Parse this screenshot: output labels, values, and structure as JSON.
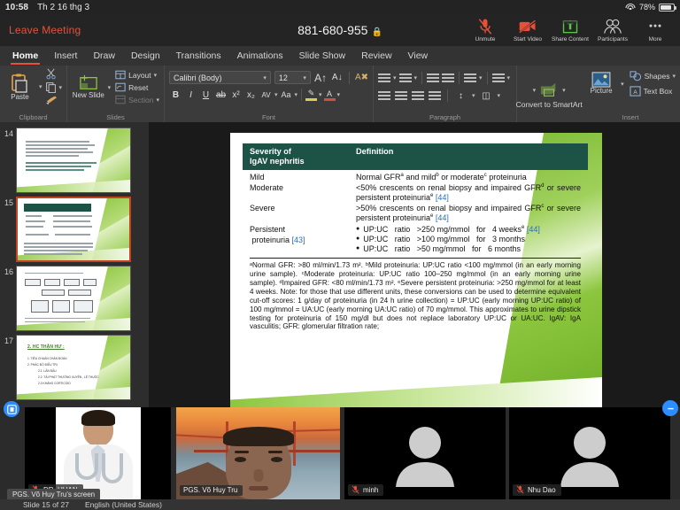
{
  "status_bar": {
    "time": "10:58",
    "date": "Th 2 16 thg 3",
    "battery_percent": "78%",
    "wifi_icon": "wifi-icon",
    "battery_icon": "battery-icon"
  },
  "zoom_bar": {
    "leave_label": "Leave Meeting",
    "meeting_id": "881-680-955",
    "lock_icon": "lock-icon",
    "tools": [
      {
        "label": "Unmute",
        "icon": "microphone-muted-icon"
      },
      {
        "label": "Start Video",
        "icon": "camera-off-icon"
      },
      {
        "label": "Share Content",
        "icon": "share-upload-icon"
      },
      {
        "label": "Participants",
        "icon": "participants-icon"
      },
      {
        "label": "More",
        "icon": "more-dots-icon"
      }
    ]
  },
  "ribbon": {
    "tabs": [
      {
        "label": "Home",
        "active": true
      },
      {
        "label": "Insert",
        "active": false
      },
      {
        "label": "Draw",
        "active": false
      },
      {
        "label": "Design",
        "active": false
      },
      {
        "label": "Transitions",
        "active": false
      },
      {
        "label": "Animations",
        "active": false
      },
      {
        "label": "Slide Show",
        "active": false
      },
      {
        "label": "Review",
        "active": false
      },
      {
        "label": "View",
        "active": false
      }
    ],
    "clipboard": {
      "group_label": "Clipboard",
      "paste_label": "Paste",
      "cut_icon": "scissors-icon",
      "copy_icon": "copy-icon",
      "format_painter_icon": "format-painter-icon"
    },
    "slides": {
      "group_label": "Slides",
      "new_slide_label": "New Slide",
      "layout_label": "Layout",
      "reset_label": "Reset",
      "section_label": "Section"
    },
    "font": {
      "group_label": "Font",
      "font_name": "Calibri (Body)",
      "font_size": "12",
      "grow_icon": "increase-font-size-icon",
      "shrink_icon": "decrease-font-size-icon",
      "clear_format_icon": "clear-formatting-icon",
      "bold": "B",
      "italic": "I",
      "underline": "U",
      "strikethrough": "ab",
      "superscript": "x²",
      "subscript": "x₂",
      "char_spacing": "AV",
      "change_case": "Aa",
      "highlight_icon": "text-highlight-icon",
      "font_color_icon": "font-color-icon"
    },
    "paragraph": {
      "group_label": "Paragraph",
      "bullets_icon": "bulleted-list-icon",
      "numbering_icon": "numbered-list-icon",
      "decrease_indent_icon": "decrease-indent-icon",
      "increase_indent_icon": "increase-indent-icon",
      "line_spacing_icon": "line-spacing-icon",
      "columns_icon": "columns-icon",
      "align_left_icon": "align-left-icon",
      "align_center_icon": "align-center-icon",
      "align_right_icon": "align-right-icon",
      "justify_icon": "justify-icon",
      "text_direction_icon": "text-direction-icon",
      "align_text_icon": "align-text-icon",
      "convert_smartart_label": "Convert to SmartArt"
    },
    "insert": {
      "group_label": "Insert",
      "picture_label": "Picture",
      "shapes_label": "Shapes",
      "text_box_label": "Text Box"
    }
  },
  "thumbnails": [
    {
      "number": "14",
      "selected": false,
      "kind": "text"
    },
    {
      "number": "15",
      "selected": true,
      "kind": "table"
    },
    {
      "number": "16",
      "selected": false,
      "kind": "diagram"
    },
    {
      "number": "17",
      "selected": false,
      "kind": "title",
      "title": "2. HC THẬN HƯ :",
      "lines": [
        "1. TIÊU CHUẨN CHẨN ĐOÁN",
        "2. PHÁC ĐỒ ĐIỀU TRỊ",
        "2.1. LẦN ĐẦU",
        "2.2. TÁI PHÁT THƯỜNG XUYÊN , LỆ THUỘC",
        "2.3 KHÁNG CORTICOID"
      ]
    }
  ],
  "slide": {
    "table": {
      "header": {
        "col1": "Severity of\nIgAV nephritis",
        "col2": "Definition"
      },
      "rows": [
        {
          "term": "Mild",
          "definition": "Normal GFR<sup>a</sup> and mild<sup>b</sup> or moderate<sup>c</sup> proteinuria"
        },
        {
          "term": "Moderate",
          "definition": "<50% crescents on renal biopsy and impaired GFR<sup>d</sup> or severe persistent proteinuria<sup>e</sup> [44]"
        },
        {
          "term": "Severe",
          "definition": ">50% crescents on renal biopsy and impaired GFR<sup>c</sup> or severe persistent proteinuria<sup>e</sup> [44]"
        }
      ],
      "persistent": {
        "term": "Persistent proteinuria [43]",
        "bullets": [
          "UP:UC  ratio  >250 mg/mmol  for  4 weeks<sup>e</sup> [44]",
          "UP:UC  ratio  >100 mg/mmol  for  3 months",
          "UP:UC  ratio  >50 mg/mmol  for  6 months"
        ]
      },
      "footnote": "ᵃNormal GFR: >80 ml/min/1.73 m². ᵇMild proteinuria: UP:UC ratio <100 mg/mmol (in an early morning urine sample). ᶜModerate proteinuria: UP:UC ratio 100–250 mg/mmol (in an early morning urine sample). ᵈImpaired GFR: <80 ml/min/1.73 m². ᵉSevere persistent proteinuria: >250 mg/mmol for at least 4 weeks. Note: for those that use different units, these conversions can be used to determine equivalent cut-off scores: 1 g/day of proteinuria (in 24 h urine collection) = UP:UC (early morning UP:UC ratio) of 100 mg/mmol = UA:UC (early morning UA:UC ratio) of 70 mg/mmol. This approximates to urine dipstick testing for proteinuria of 150 mg/dl but does not replace laboratory UP:UC or UA:UC. IgAV: IgA vasculitis; GFR: glomerular filtration rate;"
    }
  },
  "video_strip": {
    "tiles": [
      {
        "name": "DR. HUAN",
        "muted": true,
        "active": false,
        "kind": "doctor-photo"
      },
      {
        "name": "PGS. Võ Huy Tru",
        "muted": false,
        "active": true,
        "kind": "bridge-webcam"
      },
      {
        "name": "minh",
        "muted": true,
        "active": false,
        "kind": "avatar"
      },
      {
        "name": "Nhu Dao",
        "muted": true,
        "active": false,
        "kind": "avatar"
      }
    ],
    "screen_share_label": "PGS. Võ Huy Tru's screen",
    "expand_icon": "expand-video-icon",
    "minimize_icon": "minimize-icon"
  },
  "ppt_status": {
    "slide_indicator": "Slide 15 of 27",
    "language": "English (United States)"
  },
  "colors": {
    "accent_red": "#e8503a",
    "active_speaker_green": "#6ed44a",
    "zoom_blue": "#2d8cff",
    "table_header_green": "#1d5246",
    "reference_blue": "#2a6ebb",
    "selected_thumb_border": "#c1441e"
  }
}
